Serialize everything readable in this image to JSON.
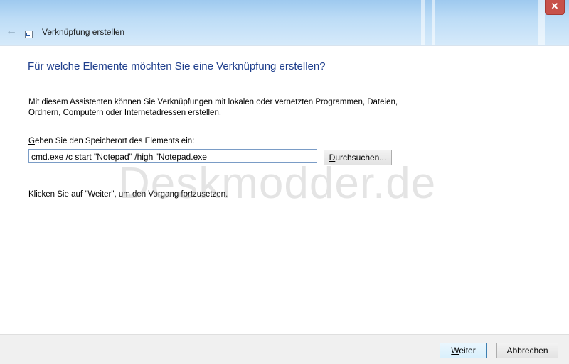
{
  "window": {
    "title": "Verknüpfung erstellen",
    "close_symbol": "✕",
    "icons": {
      "back": "back-arrow-icon",
      "app": "shortcut-icon",
      "close": "close-icon"
    }
  },
  "main": {
    "heading": "Für welche Elemente möchten Sie eine Verknüpfung erstellen?",
    "description_line1": "Mit diesem Assistenten können Sie Verknüpfungen mit lokalen oder vernetzten Programmen, Dateien,",
    "description_line2": "Ordnern, Computern oder Internetadressen erstellen.",
    "field_label_accel": "G",
    "field_label_rest": "eben Sie den Speicherort des Elements ein:",
    "location_value": "cmd.exe /c start \"Notepad\" /high \"Notepad.exe",
    "browse_accel": "D",
    "browse_rest": "urchsuchen...",
    "hint": "Klicken Sie auf \"Weiter\", um den Vorgang fortzusetzen.",
    "watermark": "Deskmodder.de"
  },
  "footer": {
    "next_accel": "W",
    "next_rest": "eiter",
    "cancel_label": "Abbrechen"
  },
  "colors": {
    "heading": "#1e3e8c",
    "glass": "#bcdcf6",
    "close": "#c7514a"
  }
}
